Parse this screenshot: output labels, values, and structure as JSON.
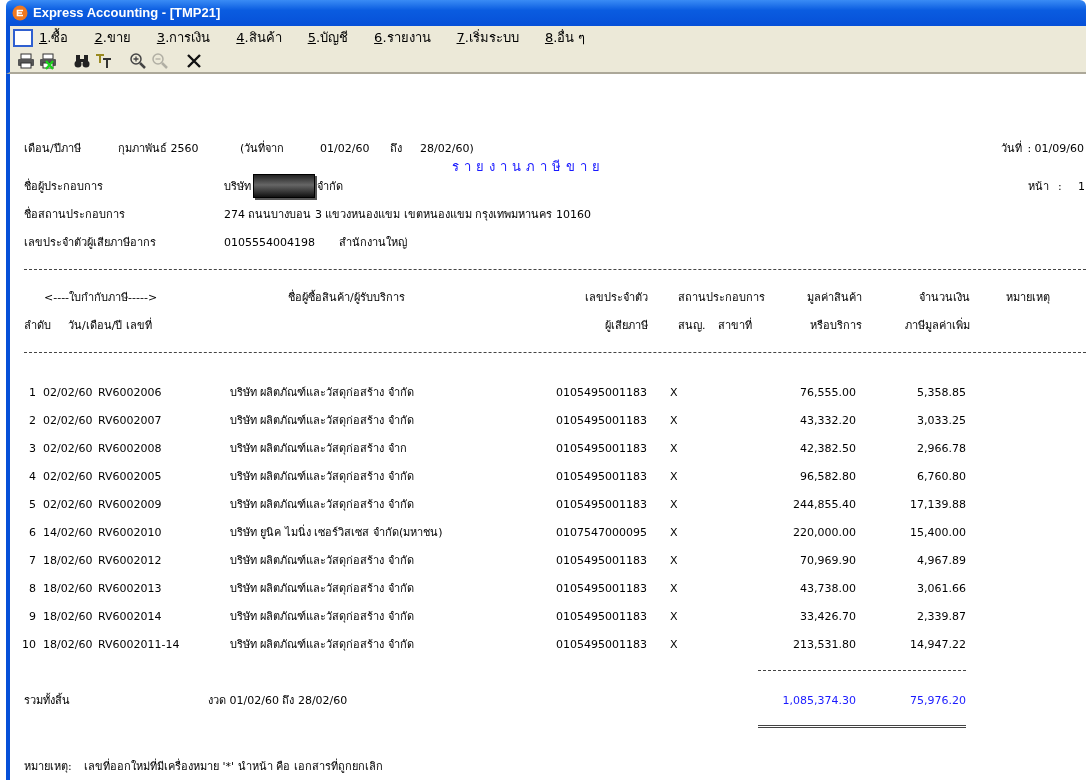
{
  "window": {
    "title": "Express Accounting - [TMP21]"
  },
  "menu": [
    {
      "label": "1.ซื้อ"
    },
    {
      "label": "2.ขาย"
    },
    {
      "label": "3.การเงิน"
    },
    {
      "label": "4.สินค้า"
    },
    {
      "label": "5.บัญชี"
    },
    {
      "label": "6.รายงาน"
    },
    {
      "label": "7.เริ่มระบบ"
    },
    {
      "label": "8.อื่น ๆ"
    }
  ],
  "toolbar": [
    {
      "kind": "print",
      "disabled": false
    },
    {
      "kind": "export",
      "disabled": false
    },
    {
      "kind": "find",
      "disabled": false
    },
    {
      "kind": "font",
      "disabled": false
    },
    {
      "kind": "zoom-in",
      "disabled": false
    },
    {
      "kind": "zoom-out",
      "disabled": true
    },
    {
      "kind": "close",
      "disabled": false
    }
  ],
  "report": {
    "period_label": "เดือน/ปีภาษี",
    "period": "กุมภาพันธ์ 2560",
    "from_label": "(วันที่จาก",
    "from": "01/02/60",
    "to_label": "ถึง",
    "to": "28/02/60)",
    "date_label": "วันที่",
    "date": ": 01/09/60",
    "title": "รายงานภาษีขาย",
    "company_label": "ชื่อผู้ประกอบการ",
    "company_prefix": "บริษัท",
    "company_suffix": "จำกัด",
    "company_redacted": true,
    "page_label": "หน้า",
    "page_sep": ":",
    "page": "1",
    "address_label": "ชื่อสถานประกอบการ",
    "address": "274 ถนนบางบอน 3 แขวงหนองแขม เขตหนองแขม กรุงเทพมหานคร 10160",
    "taxid_label": "เลขประจำตัวผู้เสียภาษีอากร",
    "taxid": "0105554004198",
    "office": "สำนักงานใหญ่",
    "header": {
      "invoice": "<----ใบกำกับภาษี----->",
      "buyer": "ชื่อผู้ซื้อสินค้า/ผู้รับบริการ",
      "taxid_1": "เลขประจำตัว",
      "taxid_2": "ผู้เสียภาษี",
      "branch": "สถานประกอบการ",
      "hq": "สนญ.",
      "branch_no": "สาขาที่",
      "value_1": "มูลค่าสินค้า",
      "value_2": "หรือบริการ",
      "vat_1": "จำนวนเงิน",
      "vat_2": "ภาษีมูลค่าเพิ่ม",
      "remark": "หมายเหตุ",
      "seq": "ลำดับ",
      "date_no": "วัน/เดือน/ปี เลขที่"
    },
    "rows": [
      {
        "seq": "1",
        "date": "02/02/60",
        "doc": "RV6002006",
        "buyer": "บริษัท ผลิตภัณฑ์และวัสดุก่อสร้าง จำกัด",
        "taxid": "0105495001183",
        "hq": "X",
        "value": "76,555.00",
        "vat": "5,358.85"
      },
      {
        "seq": "2",
        "date": "02/02/60",
        "doc": "RV6002007",
        "buyer": "บริษัท ผลิตภัณฑ์และวัสดุก่อสร้าง จำกัด",
        "taxid": "0105495001183",
        "hq": "X",
        "value": "43,332.20",
        "vat": "3,033.25"
      },
      {
        "seq": "3",
        "date": "02/02/60",
        "doc": "RV6002008",
        "buyer": "บริษัท ผลิตภัณฑ์และวัสดุก่อสร้าง จำก",
        "taxid": "0105495001183",
        "hq": "X",
        "value": "42,382.50",
        "vat": "2,966.78"
      },
      {
        "seq": "4",
        "date": "02/02/60",
        "doc": "RV6002005",
        "buyer": "บริษัท ผลิตภัณฑ์และวัสดุก่อสร้าง จำกัด",
        "taxid": "0105495001183",
        "hq": "X",
        "value": "96,582.80",
        "vat": "6,760.80"
      },
      {
        "seq": "5",
        "date": "02/02/60",
        "doc": "RV6002009",
        "buyer": "บริษัท ผลิตภัณฑ์และวัสดุก่อสร้าง จำกัด",
        "taxid": "0105495001183",
        "hq": "X",
        "value": "244,855.40",
        "vat": "17,139.88"
      },
      {
        "seq": "6",
        "date": "14/02/60",
        "doc": "RV6002010",
        "buyer": "บริษัท ยูนิค ไมนิ่ง เซอร์วิสเซส จำกัด(มหาชน)",
        "taxid": "0107547000095",
        "hq": "X",
        "value": "220,000.00",
        "vat": "15,400.00"
      },
      {
        "seq": "7",
        "date": "18/02/60",
        "doc": "RV6002012",
        "buyer": "บริษัท ผลิตภัณฑ์และวัสดุก่อสร้าง จำกัด",
        "taxid": "0105495001183",
        "hq": "X",
        "value": "70,969.90",
        "vat": "4,967.89"
      },
      {
        "seq": "8",
        "date": "18/02/60",
        "doc": "RV6002013",
        "buyer": "บริษัท ผลิตภัณฑ์และวัสดุก่อสร้าง จำกัด",
        "taxid": "0105495001183",
        "hq": "X",
        "value": "43,738.00",
        "vat": "3,061.66"
      },
      {
        "seq": "9",
        "date": "18/02/60",
        "doc": "RV6002014",
        "buyer": "บริษัท ผลิตภัณฑ์และวัสดุก่อสร้าง จำกัด",
        "taxid": "0105495001183",
        "hq": "X",
        "value": "33,426.70",
        "vat": "2,339.87"
      },
      {
        "seq": "10",
        "date": "18/02/60",
        "doc": "RV6002011-14",
        "buyer": "บริษัท ผลิตภัณฑ์และวัสดุก่อสร้าง จำกัด",
        "taxid": "0105495001183",
        "hq": "X",
        "value": "213,531.80",
        "vat": "14,947.22"
      }
    ],
    "total": {
      "label": "รวมทั้งสิ้น",
      "period": "งวด 01/02/60 ถึง 28/02/60",
      "value": "1,085,374.30",
      "vat": "75,976.20"
    },
    "note_label": "หมายเหตุ:",
    "note": "เลขที่ออกใหม่ที่มีเครื่องหมาย '*' นำหน้า คือ เอกสารที่ถูกยกเลิก"
  }
}
